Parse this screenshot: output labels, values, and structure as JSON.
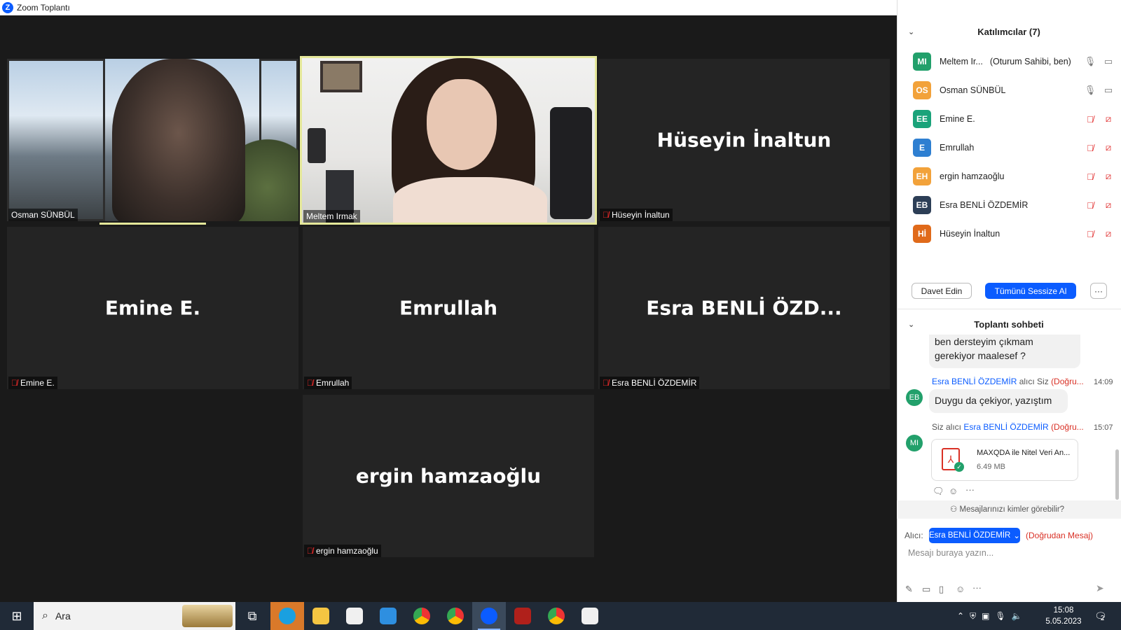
{
  "window": {
    "title": "Zoom Toplantı",
    "logo_letter": "Z",
    "minimize": "—",
    "restore": "❐",
    "close": "✕"
  },
  "tiles": [
    {
      "label": "Osman SÜNBÜL",
      "muted": false,
      "video": true
    },
    {
      "label": "Meltem Irmak",
      "muted": false,
      "video": true
    },
    {
      "name": "Hüseyin İnaltun",
      "label": "Hüseyin İnaltun",
      "muted": true
    },
    {
      "name": "Emine E.",
      "label": "Emine E.",
      "muted": true
    },
    {
      "name": "Emrullah",
      "label": "Emrullah",
      "muted": true
    },
    {
      "name": "Esra  BENLİ  ÖZD...",
      "label": "Esra BENLİ ÖZDEMİR",
      "muted": true
    },
    {
      "name": "ergin hamzaoğlu",
      "label": "ergin hamzaoğlu",
      "muted": true
    }
  ],
  "participants_panel": {
    "title": "Katılımcılar (7)",
    "items": [
      {
        "initials": "MI",
        "name": "Meltem Ir...",
        "role": "(Oturum Sahibi, ben)",
        "color": "#22a06b",
        "muted": false
      },
      {
        "initials": "OS",
        "name": "Osman SÜNBÜL",
        "role": "",
        "color": "#f2a23a",
        "muted": false
      },
      {
        "initials": "EE",
        "name": "Emine E.",
        "role": "",
        "color": "#1aa37a",
        "muted": true
      },
      {
        "initials": "E",
        "name": "Emrullah",
        "role": "",
        "color": "#2e7fd1",
        "muted": true
      },
      {
        "initials": "EH",
        "name": "ergin hamzaoğlu",
        "role": "",
        "color": "#f2a23a",
        "muted": true
      },
      {
        "initials": "EB",
        "name": "Esra BENLİ ÖZDEMİR",
        "role": "",
        "color": "#2c3e56",
        "muted": true
      },
      {
        "initials": "Hİ",
        "name": "Hüseyin İnaltun",
        "role": "",
        "color": "#e06a1a",
        "muted": true
      }
    ],
    "invite_label": "Davet Edin",
    "mute_all_label": "Tümünü Sessize Al",
    "more_label": "···"
  },
  "chat": {
    "title": "Toplantı sohbeti",
    "partial_message": [
      "ben dersteyim çıkmam",
      "gerekiyor maalesef ?"
    ],
    "msg1": {
      "sender": "Esra BENLİ ÖZDEMİR",
      "to": "alıcı Siz",
      "direct": "(Doğru...",
      "time": "14:09",
      "avatar": "EB",
      "text": "Duygu da çekiyor, yazıştım"
    },
    "msg2": {
      "from": "Siz alıcı",
      "recipient": "Esra BENLİ ÖZDEMİR",
      "direct": "(Doğru...",
      "time": "15:07",
      "avatar": "MI",
      "file_name": "MAXQDA ile Nitel Veri An...",
      "file_size": "6.49 MB"
    },
    "who_can_see": "Mesajlarınızı kimler görebilir?",
    "to_label": "Alıcı:",
    "recipient_button": "Esra BENLİ ÖZDEMİR",
    "direct_message": "(Doğrudan Mesaj)",
    "input_placeholder": "Mesajı buraya yazın..."
  },
  "taskbar": {
    "search_placeholder": "Ara",
    "time": "15:08",
    "date": "5.05.2023",
    "notification_count": "2"
  },
  "colors": {
    "accent": "#0b5cff",
    "active_speaker": "#e5e89a",
    "mute_red": "#e02828"
  }
}
